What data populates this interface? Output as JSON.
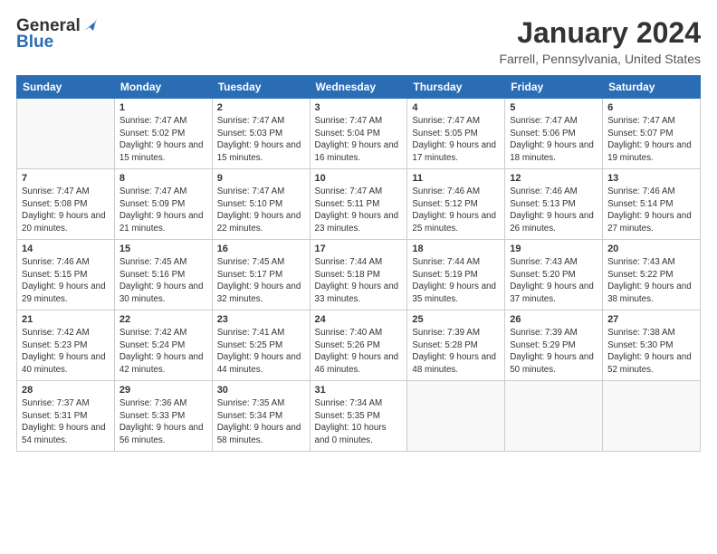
{
  "logo": {
    "general": "General",
    "blue": "Blue"
  },
  "title": "January 2024",
  "subtitle": "Farrell, Pennsylvania, United States",
  "weekdays": [
    "Sunday",
    "Monday",
    "Tuesday",
    "Wednesday",
    "Thursday",
    "Friday",
    "Saturday"
  ],
  "weeks": [
    [
      {
        "day": "",
        "sunrise": "",
        "sunset": "",
        "daylight": ""
      },
      {
        "day": "1",
        "sunrise": "Sunrise: 7:47 AM",
        "sunset": "Sunset: 5:02 PM",
        "daylight": "Daylight: 9 hours and 15 minutes."
      },
      {
        "day": "2",
        "sunrise": "Sunrise: 7:47 AM",
        "sunset": "Sunset: 5:03 PM",
        "daylight": "Daylight: 9 hours and 15 minutes."
      },
      {
        "day": "3",
        "sunrise": "Sunrise: 7:47 AM",
        "sunset": "Sunset: 5:04 PM",
        "daylight": "Daylight: 9 hours and 16 minutes."
      },
      {
        "day": "4",
        "sunrise": "Sunrise: 7:47 AM",
        "sunset": "Sunset: 5:05 PM",
        "daylight": "Daylight: 9 hours and 17 minutes."
      },
      {
        "day": "5",
        "sunrise": "Sunrise: 7:47 AM",
        "sunset": "Sunset: 5:06 PM",
        "daylight": "Daylight: 9 hours and 18 minutes."
      },
      {
        "day": "6",
        "sunrise": "Sunrise: 7:47 AM",
        "sunset": "Sunset: 5:07 PM",
        "daylight": "Daylight: 9 hours and 19 minutes."
      }
    ],
    [
      {
        "day": "7",
        "sunrise": "Sunrise: 7:47 AM",
        "sunset": "Sunset: 5:08 PM",
        "daylight": "Daylight: 9 hours and 20 minutes."
      },
      {
        "day": "8",
        "sunrise": "Sunrise: 7:47 AM",
        "sunset": "Sunset: 5:09 PM",
        "daylight": "Daylight: 9 hours and 21 minutes."
      },
      {
        "day": "9",
        "sunrise": "Sunrise: 7:47 AM",
        "sunset": "Sunset: 5:10 PM",
        "daylight": "Daylight: 9 hours and 22 minutes."
      },
      {
        "day": "10",
        "sunrise": "Sunrise: 7:47 AM",
        "sunset": "Sunset: 5:11 PM",
        "daylight": "Daylight: 9 hours and 23 minutes."
      },
      {
        "day": "11",
        "sunrise": "Sunrise: 7:46 AM",
        "sunset": "Sunset: 5:12 PM",
        "daylight": "Daylight: 9 hours and 25 minutes."
      },
      {
        "day": "12",
        "sunrise": "Sunrise: 7:46 AM",
        "sunset": "Sunset: 5:13 PM",
        "daylight": "Daylight: 9 hours and 26 minutes."
      },
      {
        "day": "13",
        "sunrise": "Sunrise: 7:46 AM",
        "sunset": "Sunset: 5:14 PM",
        "daylight": "Daylight: 9 hours and 27 minutes."
      }
    ],
    [
      {
        "day": "14",
        "sunrise": "Sunrise: 7:46 AM",
        "sunset": "Sunset: 5:15 PM",
        "daylight": "Daylight: 9 hours and 29 minutes."
      },
      {
        "day": "15",
        "sunrise": "Sunrise: 7:45 AM",
        "sunset": "Sunset: 5:16 PM",
        "daylight": "Daylight: 9 hours and 30 minutes."
      },
      {
        "day": "16",
        "sunrise": "Sunrise: 7:45 AM",
        "sunset": "Sunset: 5:17 PM",
        "daylight": "Daylight: 9 hours and 32 minutes."
      },
      {
        "day": "17",
        "sunrise": "Sunrise: 7:44 AM",
        "sunset": "Sunset: 5:18 PM",
        "daylight": "Daylight: 9 hours and 33 minutes."
      },
      {
        "day": "18",
        "sunrise": "Sunrise: 7:44 AM",
        "sunset": "Sunset: 5:19 PM",
        "daylight": "Daylight: 9 hours and 35 minutes."
      },
      {
        "day": "19",
        "sunrise": "Sunrise: 7:43 AM",
        "sunset": "Sunset: 5:20 PM",
        "daylight": "Daylight: 9 hours and 37 minutes."
      },
      {
        "day": "20",
        "sunrise": "Sunrise: 7:43 AM",
        "sunset": "Sunset: 5:22 PM",
        "daylight": "Daylight: 9 hours and 38 minutes."
      }
    ],
    [
      {
        "day": "21",
        "sunrise": "Sunrise: 7:42 AM",
        "sunset": "Sunset: 5:23 PM",
        "daylight": "Daylight: 9 hours and 40 minutes."
      },
      {
        "day": "22",
        "sunrise": "Sunrise: 7:42 AM",
        "sunset": "Sunset: 5:24 PM",
        "daylight": "Daylight: 9 hours and 42 minutes."
      },
      {
        "day": "23",
        "sunrise": "Sunrise: 7:41 AM",
        "sunset": "Sunset: 5:25 PM",
        "daylight": "Daylight: 9 hours and 44 minutes."
      },
      {
        "day": "24",
        "sunrise": "Sunrise: 7:40 AM",
        "sunset": "Sunset: 5:26 PM",
        "daylight": "Daylight: 9 hours and 46 minutes."
      },
      {
        "day": "25",
        "sunrise": "Sunrise: 7:39 AM",
        "sunset": "Sunset: 5:28 PM",
        "daylight": "Daylight: 9 hours and 48 minutes."
      },
      {
        "day": "26",
        "sunrise": "Sunrise: 7:39 AM",
        "sunset": "Sunset: 5:29 PM",
        "daylight": "Daylight: 9 hours and 50 minutes."
      },
      {
        "day": "27",
        "sunrise": "Sunrise: 7:38 AM",
        "sunset": "Sunset: 5:30 PM",
        "daylight": "Daylight: 9 hours and 52 minutes."
      }
    ],
    [
      {
        "day": "28",
        "sunrise": "Sunrise: 7:37 AM",
        "sunset": "Sunset: 5:31 PM",
        "daylight": "Daylight: 9 hours and 54 minutes."
      },
      {
        "day": "29",
        "sunrise": "Sunrise: 7:36 AM",
        "sunset": "Sunset: 5:33 PM",
        "daylight": "Daylight: 9 hours and 56 minutes."
      },
      {
        "day": "30",
        "sunrise": "Sunrise: 7:35 AM",
        "sunset": "Sunset: 5:34 PM",
        "daylight": "Daylight: 9 hours and 58 minutes."
      },
      {
        "day": "31",
        "sunrise": "Sunrise: 7:34 AM",
        "sunset": "Sunset: 5:35 PM",
        "daylight": "Daylight: 10 hours and 0 minutes."
      },
      {
        "day": "",
        "sunrise": "",
        "sunset": "",
        "daylight": ""
      },
      {
        "day": "",
        "sunrise": "",
        "sunset": "",
        "daylight": ""
      },
      {
        "day": "",
        "sunrise": "",
        "sunset": "",
        "daylight": ""
      }
    ]
  ]
}
